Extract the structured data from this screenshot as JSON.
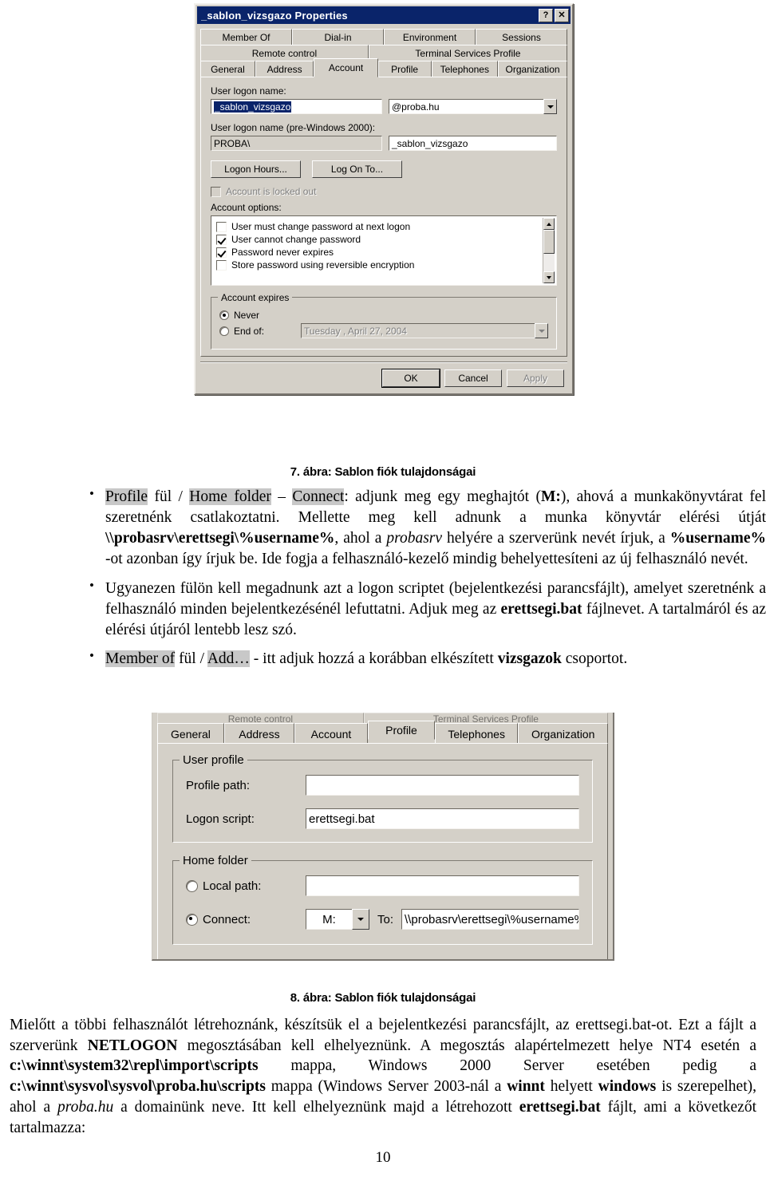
{
  "dialog1": {
    "title": "_sablon_vizsgazo Properties",
    "title_buttons": [
      {
        "name": "help-button",
        "glyph": "?"
      },
      {
        "name": "close-button",
        "glyph": "✕"
      }
    ],
    "tab_rows": [
      [
        "Member Of",
        "Dial-in",
        "Environment",
        "Sessions"
      ],
      [
        "Remote control",
        "Terminal Services Profile"
      ],
      [
        "General",
        "Address",
        "Account",
        "Profile",
        "Telephones",
        "Organization"
      ]
    ],
    "active_tab": "Account",
    "user_logon_name_label": "User logon name:",
    "user_logon_name_value": "_sablon_vizsgazo",
    "upn_suffix_value": "@proba.hu",
    "pre2000_label": "User logon name (pre-Windows 2000):",
    "pre2000_domain": "PROBA\\",
    "pre2000_value": "_sablon_vizsgazo",
    "logon_hours_button": "Logon Hours...",
    "log_on_to_button": "Log On To...",
    "account_locked_label": "Account is locked out",
    "account_options_label": "Account options:",
    "account_options": [
      {
        "label": "User must change password at next logon",
        "checked": false
      },
      {
        "label": "User cannot change password",
        "checked": true
      },
      {
        "label": "Password never expires",
        "checked": true
      },
      {
        "label": "Store password using reversible encryption",
        "checked": false
      }
    ],
    "account_expires_group": "Account expires",
    "never_label": "Never",
    "end_of_label": "End of:",
    "end_of_date": "Tuesday   ,   April    27, 2004",
    "buttons": {
      "ok": "OK",
      "cancel": "Cancel",
      "apply": "Apply"
    }
  },
  "caption1": "7. ábra: Sablon fiók tulajdonságai",
  "bullets": [
    {
      "segments": [
        {
          "t": "Profile",
          "style": "hl"
        },
        {
          "t": " fül / ",
          "style": ""
        },
        {
          "t": "Home folder",
          "style": "hl"
        },
        {
          "t": " – ",
          "style": ""
        },
        {
          "t": "Connect",
          "style": "hl"
        },
        {
          "t": ": adjunk meg egy meghajtót (",
          "style": ""
        },
        {
          "t": "M:",
          "style": "b"
        },
        {
          "t": "), ahová a munkakönyvtárat fel szeretnénk csatlakoztatni. Mellette meg kell adnunk a munka könyvtár elérési útját ",
          "style": ""
        },
        {
          "t": "\\\\probasrv\\erettsegi\\%username%",
          "style": "b"
        },
        {
          "t": ", ahol a ",
          "style": ""
        },
        {
          "t": "probasrv",
          "style": "i"
        },
        {
          "t": " helyére a szerverünk nevét írjuk, a ",
          "style": ""
        },
        {
          "t": "%username%",
          "style": "b"
        },
        {
          "t": " -ot azonban így írjuk be. Ide fogja a felhasználó-kezelő mindig behelyettesíteni az új felhasználó nevét.",
          "style": ""
        }
      ]
    },
    {
      "segments": [
        {
          "t": "Ugyanezen fülön kell megadnunk azt a logon scriptet (bejelentkezési parancsfájlt), amelyet szeretnénk a felhasználó minden bejelentkezésénél lefuttatni. Adjuk meg az ",
          "style": ""
        },
        {
          "t": "erettsegi.bat",
          "style": "b"
        },
        {
          "t": " fájlnevet. A tartalmáról és az elérési útjáról lentebb lesz szó.",
          "style": ""
        }
      ]
    },
    {
      "segments": [
        {
          "t": "Member of",
          "style": "hl"
        },
        {
          "t": " fül / ",
          "style": ""
        },
        {
          "t": "Add…",
          "style": "hl"
        },
        {
          "t": " - itt adjuk hozzá a korábban elkészített ",
          "style": ""
        },
        {
          "t": "vizsgazok",
          "style": "b"
        },
        {
          "t": " csoportot.",
          "style": ""
        }
      ]
    }
  ],
  "dialog2": {
    "tab_rows": [
      [
        "Remote control",
        "Terminal Services Profile"
      ],
      [
        "General",
        "Address",
        "Account",
        "Profile",
        "Telephones",
        "Organization"
      ]
    ],
    "active_tab": "Profile",
    "user_profile_group": "User profile",
    "profile_path_label": "Profile path:",
    "profile_path_value": "",
    "logon_script_label": "Logon script:",
    "logon_script_value": "erettsegi.bat",
    "home_folder_group": "Home folder",
    "local_path_label": "Local path:",
    "local_path_value": "",
    "connect_label": "Connect:",
    "connect_drive": "M:",
    "to_label": "To:",
    "to_value": "\\\\probasrv\\erettsegi\\%username%"
  },
  "caption2": "8. ábra: Sablon fiók tulajdonságai",
  "closing_paragraph": {
    "segments": [
      {
        "t": "Mielőtt a többi felhasználót létrehoznánk, készítsük el a bejelentkezési parancsfájlt, az erettsegi.bat-ot. Ezt a fájlt a szerverünk ",
        "style": ""
      },
      {
        "t": "NETLOGON",
        "style": "b"
      },
      {
        "t": " megosztásában kell elhelyeznünk. A megosztás alapértelmezett helye NT4 esetén a ",
        "style": ""
      },
      {
        "t": "c:\\winnt\\system32\\repl\\import\\scripts",
        "style": "b"
      },
      {
        "t": " mappa, Windows 2000 Server esetében pedig a ",
        "style": ""
      },
      {
        "t": "c:\\winnt\\sysvol\\sysvol\\proba.hu\\scripts",
        "style": "b"
      },
      {
        "t": " mappa (Windows Server 2003-nál a ",
        "style": ""
      },
      {
        "t": "winnt",
        "style": "b"
      },
      {
        "t": " helyett ",
        "style": ""
      },
      {
        "t": "windows",
        "style": "b"
      },
      {
        "t": " is szerepelhet), ahol a ",
        "style": ""
      },
      {
        "t": "proba.hu",
        "style": "i"
      },
      {
        "t": " a domainünk neve. Itt kell elhelyeznünk majd a létrehozott ",
        "style": ""
      },
      {
        "t": "erettsegi.bat",
        "style": "b"
      },
      {
        "t": " fájlt, ami a következőt tartalmazza:",
        "style": ""
      }
    ]
  },
  "page_number": "10",
  "colors": {
    "titlebar": "#0a246a",
    "dialog_face": "#d4d0c8",
    "highlight": "#c8c8c8"
  }
}
